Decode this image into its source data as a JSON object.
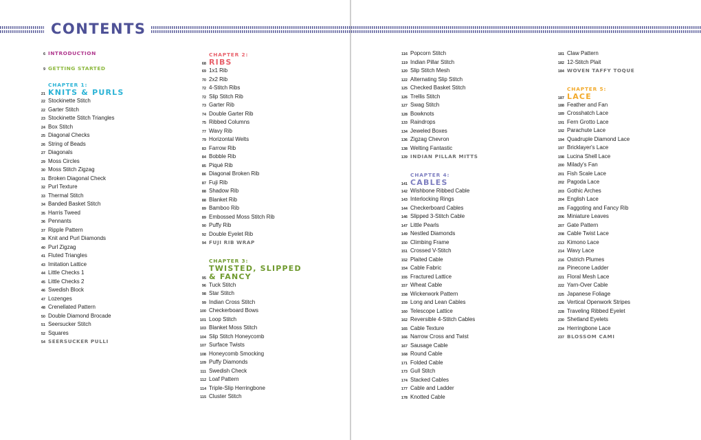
{
  "header": {
    "title": "CONTENTS"
  },
  "colors": {
    "title": "#4e5196",
    "introduction": "#b0388e",
    "getting_started": "#8cb83d",
    "chapter1": "#2bb3d6",
    "chapter2": "#e8616b",
    "chapter3": "#6f9a2e",
    "chapter4": "#7d7ec0",
    "chapter5": "#f2a92a",
    "project": "#6d6d6d"
  },
  "front": [
    {
      "page": "6",
      "label": "INTRODUCTION"
    },
    {
      "page": "9",
      "label": "GETTING STARTED"
    }
  ],
  "chapters": [
    {
      "kicker": "CHAPTER 1:",
      "title": "KNITS & PURLS",
      "page": "21",
      "entries": [
        {
          "page": "22",
          "label": "Stockinette Stitch"
        },
        {
          "page": "22",
          "label": "Garter Stitch"
        },
        {
          "page": "23",
          "label": "Stockinette Stitch Triangles"
        },
        {
          "page": "24",
          "label": "Box Stitch"
        },
        {
          "page": "25",
          "label": "Diagonal Checks"
        },
        {
          "page": "26",
          "label": "String of Beads"
        },
        {
          "page": "27",
          "label": "Diagonals"
        },
        {
          "page": "29",
          "label": "Moss Circles"
        },
        {
          "page": "30",
          "label": "Moss Stitch Zigzag"
        },
        {
          "page": "31",
          "label": "Broken Diagonal Check"
        },
        {
          "page": "32",
          "label": "Purl Texture"
        },
        {
          "page": "33",
          "label": "Thermal Stitch"
        },
        {
          "page": "34",
          "label": "Banded Basket Stitch"
        },
        {
          "page": "35",
          "label": "Harris Tweed"
        },
        {
          "page": "36",
          "label": "Pennants"
        },
        {
          "page": "37",
          "label": "Ripple Pattern"
        },
        {
          "page": "38",
          "label": "Knit and Purl Diamonds"
        },
        {
          "page": "40",
          "label": "Purl Zigzag"
        },
        {
          "page": "41",
          "label": "Fluted Triangles"
        },
        {
          "page": "43",
          "label": "Imitation Lattice"
        },
        {
          "page": "44",
          "label": "Little Checks 1"
        },
        {
          "page": "45",
          "label": "Little Checks 2"
        },
        {
          "page": "46",
          "label": "Swedish Block"
        },
        {
          "page": "47",
          "label": "Lozenges"
        },
        {
          "page": "48",
          "label": "Crenellated Pattern"
        },
        {
          "page": "50",
          "label": "Double Diamond Brocade"
        },
        {
          "page": "51",
          "label": "Seersucker Stitch"
        },
        {
          "page": "52",
          "label": "Squares"
        },
        {
          "page": "54",
          "label": "SEERSUCKER PULLI",
          "project": true
        }
      ]
    },
    {
      "kicker": "CHAPTER 2:",
      "title": "RIBS",
      "page": "68",
      "entries": [
        {
          "page": "69",
          "label": "1x1 Rib"
        },
        {
          "page": "70",
          "label": "2x2 Rib"
        },
        {
          "page": "72",
          "label": "4-Stitch Ribs"
        },
        {
          "page": "72",
          "label": "Slip Stitch Rib"
        },
        {
          "page": "73",
          "label": "Garter Rib"
        },
        {
          "page": "74",
          "label": "Double Garter Rib"
        },
        {
          "page": "75",
          "label": "Ribbed Columns"
        },
        {
          "page": "77",
          "label": "Wavy Rib"
        },
        {
          "page": "79",
          "label": "Horizontal Welts"
        },
        {
          "page": "83",
          "label": "Farrow Rib"
        },
        {
          "page": "84",
          "label": "Bobble Rib"
        },
        {
          "page": "85",
          "label": "Piqué Rib"
        },
        {
          "page": "86",
          "label": "Diagonal Broken Rib"
        },
        {
          "page": "87",
          "label": "Fuji Rib"
        },
        {
          "page": "88",
          "label": "Shadow Rib"
        },
        {
          "page": "88",
          "label": "Blanket Rib"
        },
        {
          "page": "89",
          "label": "Bamboo Rib"
        },
        {
          "page": "89",
          "label": "Embossed Moss Stitch Rib"
        },
        {
          "page": "90",
          "label": "Puffy Rib"
        },
        {
          "page": "92",
          "label": "Double Eyelet Rib"
        },
        {
          "page": "94",
          "label": "FUJI RIB WRAP",
          "project": true
        }
      ]
    },
    {
      "kicker": "CHAPTER 3:",
      "title_lines": [
        "TWISTED, SLIPPED",
        "& FANCY"
      ],
      "page": "95",
      "entries": [
        {
          "page": "96",
          "label": "Tuck Stitch"
        },
        {
          "page": "98",
          "label": "Star Stitch"
        },
        {
          "page": "99",
          "label": "Indian Cross Stitch"
        },
        {
          "page": "100",
          "label": "Checkerboard Bows"
        },
        {
          "page": "101",
          "label": "Loop Stitch"
        },
        {
          "page": "103",
          "label": "Blanket Moss Stitch"
        },
        {
          "page": "104",
          "label": "Slip Stitch Honeycomb"
        },
        {
          "page": "107",
          "label": "Surface Twists"
        },
        {
          "page": "108",
          "label": "Honeycomb Smocking"
        },
        {
          "page": "109",
          "label": "Puffy Diamonds"
        },
        {
          "page": "111",
          "label": "Swedish Check"
        },
        {
          "page": "112",
          "label": "Loaf Pattern"
        },
        {
          "page": "114",
          "label": "Triple-Slip Herringbone"
        },
        {
          "page": "115",
          "label": "Cluster Stitch"
        },
        {
          "page": "116",
          "label": "Popcorn Stitch"
        },
        {
          "page": "119",
          "label": "Indian Pillar Stitch"
        },
        {
          "page": "120",
          "label": "Slip Stitch Mesh"
        },
        {
          "page": "122",
          "label": "Alternating Slip Stitch"
        },
        {
          "page": "125",
          "label": "Checked Basket Stitch"
        },
        {
          "page": "126",
          "label": "Trellis Stitch"
        },
        {
          "page": "127",
          "label": "Swag Stitch"
        },
        {
          "page": "128",
          "label": "Bowknots"
        },
        {
          "page": "133",
          "label": "Raindrops"
        },
        {
          "page": "134",
          "label": "Jeweled Boxes"
        },
        {
          "page": "136",
          "label": "Zigzag Chevron"
        },
        {
          "page": "138",
          "label": "Welting Fantastic"
        },
        {
          "page": "139",
          "label": "INDIAN PILLAR MITTS",
          "project": true
        }
      ]
    },
    {
      "kicker": "CHAPTER 4:",
      "title": "CABLES",
      "page": "141",
      "entries": [
        {
          "page": "142",
          "label": "Wishbone Ribbed Cable"
        },
        {
          "page": "143",
          "label": "Interlocking Rings"
        },
        {
          "page": "144",
          "label": "Checkerboard Cables"
        },
        {
          "page": "146",
          "label": "Slipped 3-Stitch Cable"
        },
        {
          "page": "147",
          "label": "Little Pearls"
        },
        {
          "page": "149",
          "label": "Nestled Diamonds"
        },
        {
          "page": "150",
          "label": "Climbing Frame"
        },
        {
          "page": "151",
          "label": "Crossed V-Stitch"
        },
        {
          "page": "152",
          "label": "Plaited Cable"
        },
        {
          "page": "154",
          "label": "Cable Fabric"
        },
        {
          "page": "155",
          "label": "Fractured Lattice"
        },
        {
          "page": "157",
          "label": "Wheat Cable"
        },
        {
          "page": "158",
          "label": "Wickerwork Pattern"
        },
        {
          "page": "159",
          "label": "Long and Lean Cables"
        },
        {
          "page": "160",
          "label": "Telescope Lattice"
        },
        {
          "page": "162",
          "label": "Reversible 4-Stitch Cables"
        },
        {
          "page": "165",
          "label": "Cable Texture"
        },
        {
          "page": "166",
          "label": "Narrow Cross and Twist"
        },
        {
          "page": "167",
          "label": "Sausage Cable"
        },
        {
          "page": "168",
          "label": "Round Cable"
        },
        {
          "page": "171",
          "label": "Folded Cable"
        },
        {
          "page": "173",
          "label": "Gull Stitch"
        },
        {
          "page": "174",
          "label": "Stacked Cables"
        },
        {
          "page": "177",
          "label": "Cable and Ladder"
        },
        {
          "page": "178",
          "label": "Knotted Cable"
        },
        {
          "page": "181",
          "label": "Claw Pattern"
        },
        {
          "page": "182",
          "label": "12-Stitch Plait"
        },
        {
          "page": "184",
          "label": "WOVEN TAFFY TOQUE",
          "project": true
        }
      ]
    },
    {
      "kicker": "CHAPTER 5:",
      "title": "LACE",
      "page": "187",
      "entries": [
        {
          "page": "188",
          "label": "Feather and Fan"
        },
        {
          "page": "189",
          "label": "Crosshatch Lace"
        },
        {
          "page": "191",
          "label": "Fern Grotto Lace"
        },
        {
          "page": "192",
          "label": "Parachute Lace"
        },
        {
          "page": "194",
          "label": "Quadruple Diamond Lace"
        },
        {
          "page": "197",
          "label": "Bricklayer's Lace"
        },
        {
          "page": "198",
          "label": "Lucina Shell Lace"
        },
        {
          "page": "200",
          "label": "Milady's Fan"
        },
        {
          "page": "201",
          "label": "Fish Scale Lace"
        },
        {
          "page": "202",
          "label": "Pagoda Lace"
        },
        {
          "page": "203",
          "label": "Gothic Arches"
        },
        {
          "page": "204",
          "label": "English Lace"
        },
        {
          "page": "205",
          "label": "Faggoting and Fancy Rib"
        },
        {
          "page": "206",
          "label": "Miniature Leaves"
        },
        {
          "page": "207",
          "label": "Gate Pattern"
        },
        {
          "page": "208",
          "label": "Cable Twist Lace"
        },
        {
          "page": "213",
          "label": "Kimono Lace"
        },
        {
          "page": "214",
          "label": "Wavy Lace"
        },
        {
          "page": "216",
          "label": "Ostrich Plumes"
        },
        {
          "page": "218",
          "label": "Pinecone Ladder"
        },
        {
          "page": "221",
          "label": "Floral Mesh Lace"
        },
        {
          "page": "222",
          "label": "Yarn-Over Cable"
        },
        {
          "page": "225",
          "label": "Japanese Foliage"
        },
        {
          "page": "226",
          "label": "Vertical Openwork Stripes"
        },
        {
          "page": "228",
          "label": "Traveling Ribbed Eyelet"
        },
        {
          "page": "230",
          "label": "Shetland Eyelets"
        },
        {
          "page": "234",
          "label": "Herringbone Lace"
        },
        {
          "page": "237",
          "label": "BLOSSOM CAMI",
          "project": true
        }
      ]
    }
  ]
}
